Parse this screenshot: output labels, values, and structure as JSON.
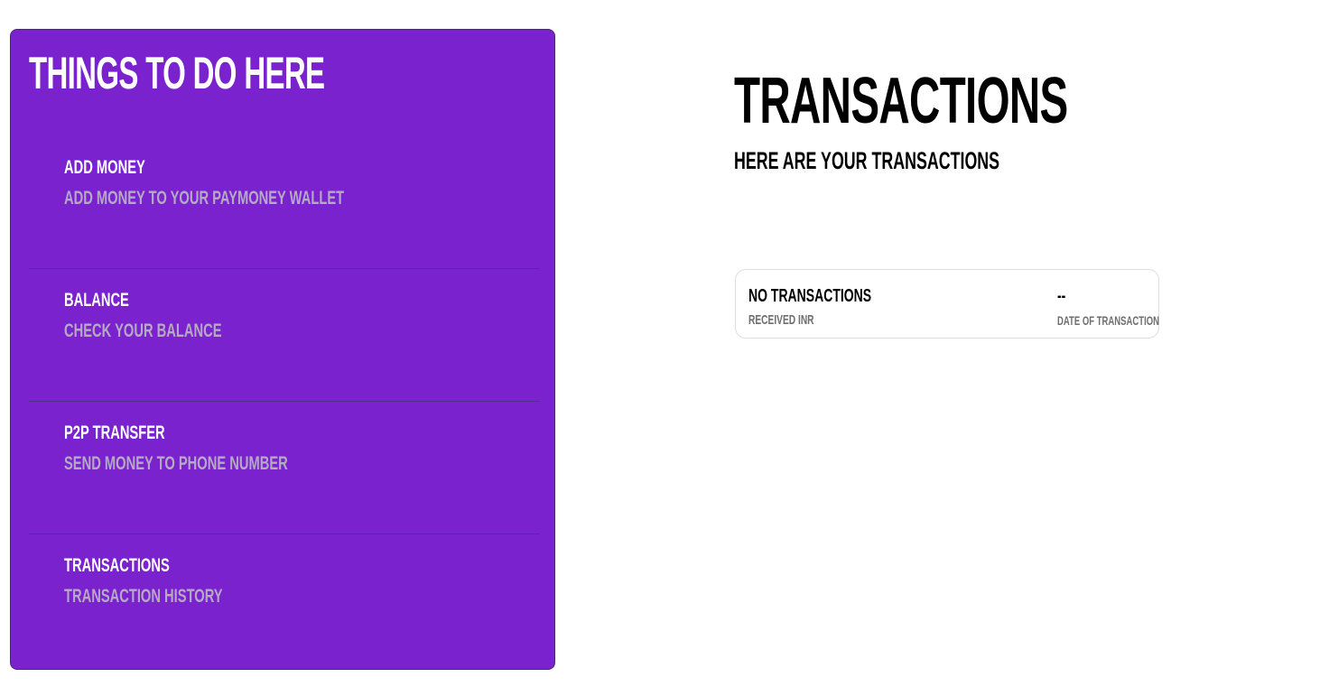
{
  "sidebar": {
    "title": "THINGS TO DO HERE",
    "items": [
      {
        "label": "ADD MONEY",
        "description": "ADD MONEY TO YOUR PAYMONEY WALLET"
      },
      {
        "label": "BALANCE",
        "description": "CHECK YOUR BALANCE"
      },
      {
        "label": "P2P TRANSFER",
        "description": "SEND MONEY TO PHONE NUMBER"
      },
      {
        "label": "TRANSACTIONS",
        "description": "TRANSACTION HISTORY"
      }
    ]
  },
  "main": {
    "title": "TRANSACTIONS",
    "subtitle": "HERE ARE YOUR TRANSACTIONS",
    "transactions": [
      {
        "name": "NO TRANSACTIONS",
        "type": "RECEIVED INR",
        "amount": "--",
        "date_label": "DATE OF TRANSACTION"
      }
    ]
  },
  "colors": {
    "panel_bg": "#7b22cf",
    "panel_muted_text": "#b5a9c4",
    "divider": "#5a2a8a"
  }
}
